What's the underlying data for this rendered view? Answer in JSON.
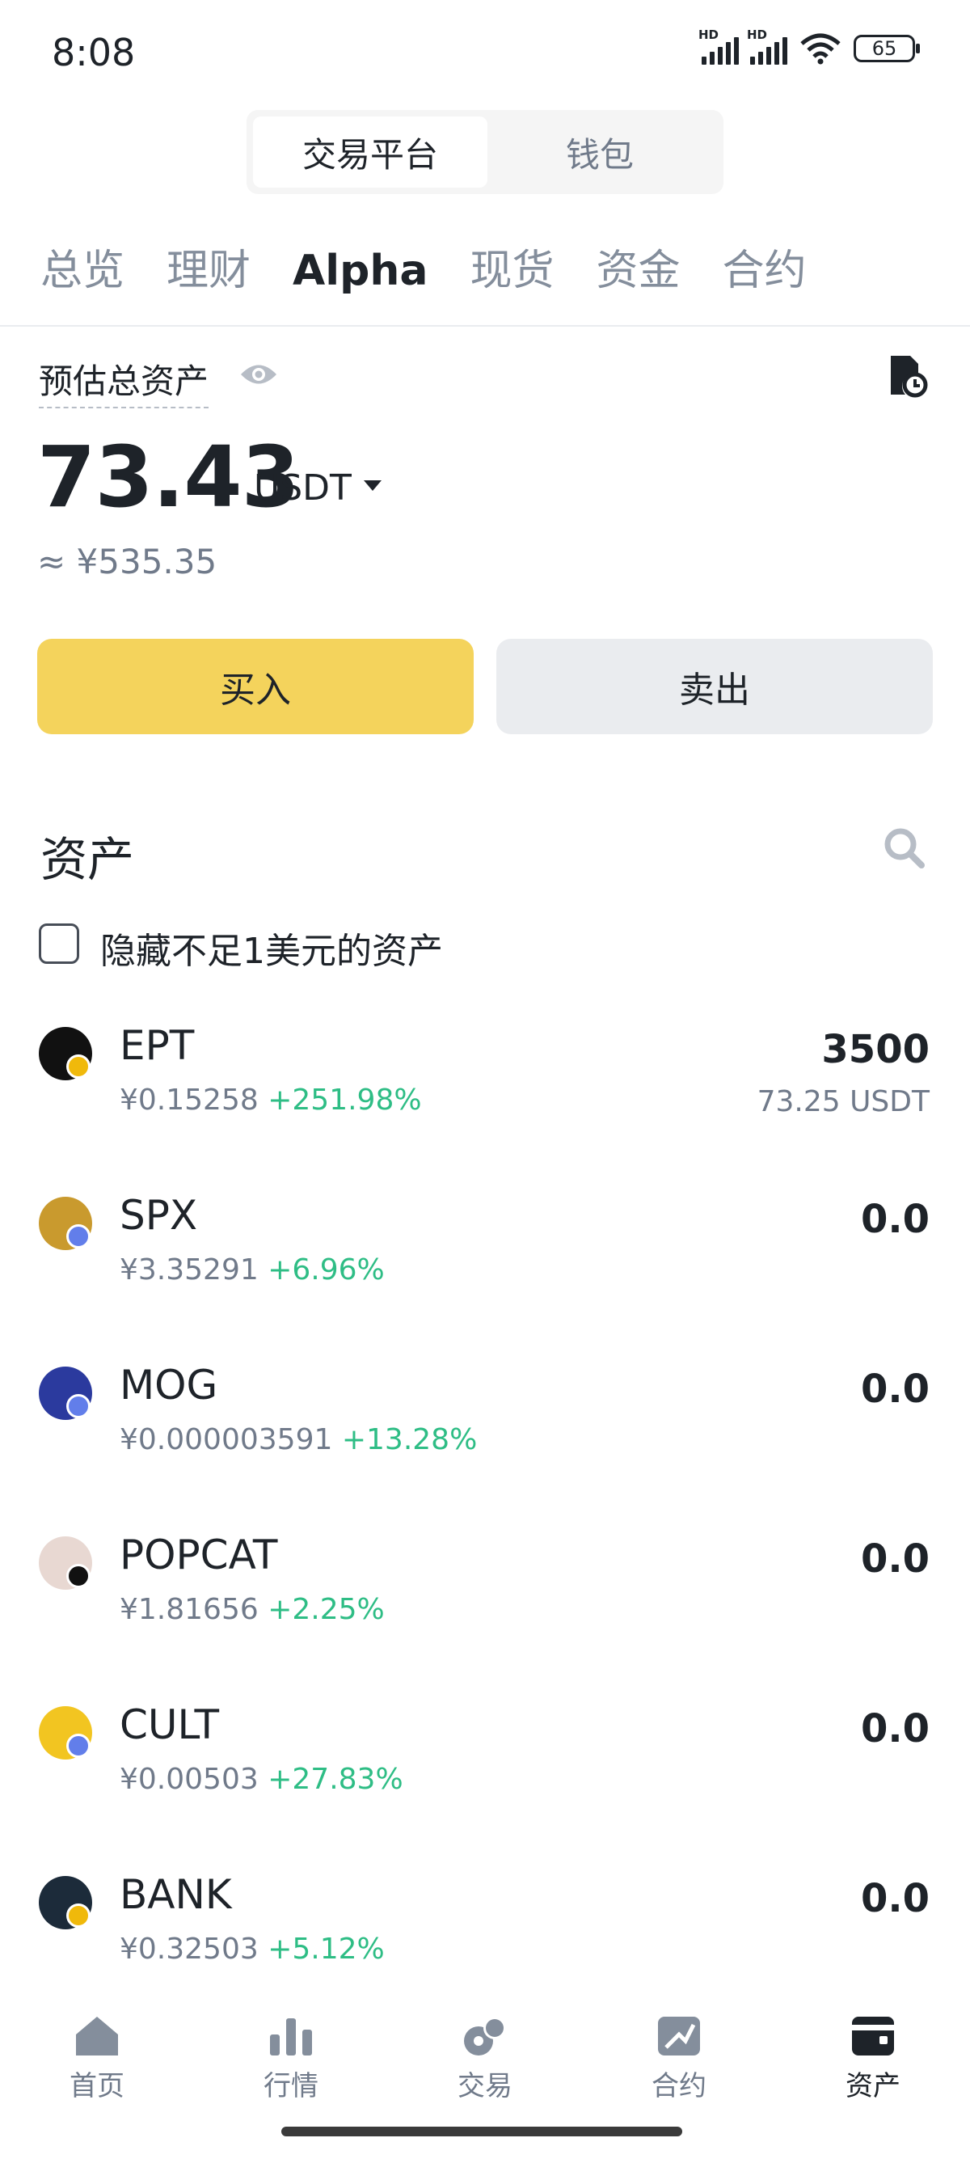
{
  "status": {
    "time": "8:08",
    "hd1": "HD",
    "hd2": "HD",
    "battery": "65"
  },
  "segment": {
    "active": "交易平台",
    "inactive": "钱包"
  },
  "tabs": [
    {
      "label": "总览",
      "active": false
    },
    {
      "label": "理财",
      "active": false
    },
    {
      "label": "Alpha",
      "active": true
    },
    {
      "label": "现货",
      "active": false
    },
    {
      "label": "资金",
      "active": false
    },
    {
      "label": "合约",
      "active": false
    }
  ],
  "balance": {
    "label": "预估总资产",
    "value": "73.43",
    "unit": "USDT",
    "approx": "≈ ¥535.35"
  },
  "actions": {
    "buy": "买入",
    "sell": "卖出"
  },
  "assets": {
    "title": "资产",
    "hide_small": "隐藏不足1美元的资产",
    "hide_small_checked": false,
    "list": [
      {
        "name": "EPT",
        "price": "¥0.15258",
        "change": "+251.98%",
        "qty": "3500",
        "usdt": "73.25 USDT",
        "icon_color": "#111111",
        "badge": "bnb-chain-icon",
        "badge_color": "#f0b90b"
      },
      {
        "name": "SPX",
        "price": "¥3.35291",
        "change": "+6.96%",
        "qty": "0.0",
        "usdt": "",
        "icon_color": "#c99a2e",
        "badge": "ethereum-icon",
        "badge_color": "#627eea"
      },
      {
        "name": "MOG",
        "price": "¥0.000003591",
        "change": "+13.28%",
        "qty": "0.0",
        "usdt": "",
        "icon_color": "#2b3a9e",
        "badge": "ethereum-icon",
        "badge_color": "#627eea"
      },
      {
        "name": "POPCAT",
        "price": "¥1.81656",
        "change": "+2.25%",
        "qty": "0.0",
        "usdt": "",
        "icon_color": "#e8d8d2",
        "badge": "solana-icon",
        "badge_color": "#111111"
      },
      {
        "name": "CULT",
        "price": "¥0.00503",
        "change": "+27.83%",
        "qty": "0.0",
        "usdt": "",
        "icon_color": "#f2c521",
        "badge": "ethereum-icon",
        "badge_color": "#627eea"
      },
      {
        "name": "BANK",
        "price": "¥0.32503",
        "change": "+5.12%",
        "qty": "0.0",
        "usdt": "",
        "icon_color": "#1c2b3a",
        "badge": "bnb-chain-icon",
        "badge_color": "#f0b90b"
      }
    ]
  },
  "nav": [
    {
      "label": "首页",
      "icon": "home-icon",
      "active": false
    },
    {
      "label": "行情",
      "icon": "markets-icon",
      "active": false
    },
    {
      "label": "交易",
      "icon": "trade-icon",
      "active": false
    },
    {
      "label": "合约",
      "icon": "futures-icon",
      "active": false
    },
    {
      "label": "资产",
      "icon": "wallet-icon",
      "active": true
    }
  ],
  "colors": {
    "accent": "#f4d35c",
    "positive": "#2ebd85",
    "text": "#1e2329",
    "muted": "#707a8a"
  }
}
